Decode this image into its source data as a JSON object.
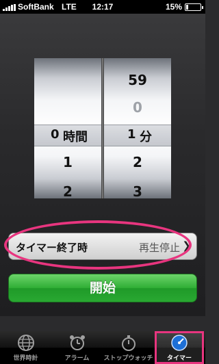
{
  "status": {
    "carrier": "SoftBank",
    "network": "LTE",
    "time": "12:17",
    "battery": "15%",
    "battery_level": 0.15
  },
  "picker": {
    "hours_items": [
      "0",
      "1",
      "2"
    ],
    "selected_hours": "0",
    "hours_unit": "時間",
    "minutes_items": [
      "59",
      "0",
      "1",
      "2",
      "3"
    ],
    "selected_minutes": "1",
    "minutes_unit": "分"
  },
  "timer_end": {
    "label": "タイマー終了時",
    "value": "再生停止"
  },
  "start_button": "開始",
  "tabs": [
    {
      "label": "世界時計",
      "icon": "globe-icon"
    },
    {
      "label": "アラーム",
      "icon": "alarm-clock-icon"
    },
    {
      "label": "ストップウォッチ",
      "icon": "stopwatch-icon"
    },
    {
      "label": "タイマー",
      "icon": "timer-icon",
      "active": true
    }
  ],
  "colors": {
    "highlight": "#e8357f",
    "start_green": "#2fae35"
  }
}
